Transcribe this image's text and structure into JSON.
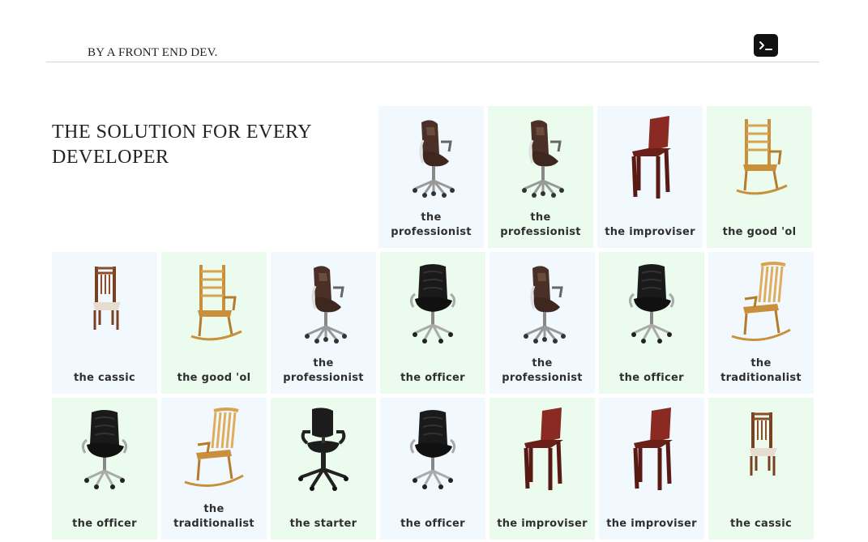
{
  "header": {
    "brand": "BY A FRONT END DEV.",
    "terminal_icon": "terminal-icon"
  },
  "hero": {
    "title": "THE SOLUTION FOR EVERY DEVELOPER"
  },
  "colors": {
    "blue_card": "#f1f8fe",
    "green_card": "#ebfcee"
  },
  "cards": [
    {
      "label": "the professionist",
      "chair": "professionist",
      "tint": "blue"
    },
    {
      "label": "the professionist",
      "chair": "professionist",
      "tint": "green"
    },
    {
      "label": "the improviser",
      "chair": "improviser",
      "tint": "blue"
    },
    {
      "label": "the good 'ol",
      "chair": "goodol",
      "tint": "green"
    },
    {
      "label": "the cassic",
      "chair": "cassic",
      "tint": "blue"
    },
    {
      "label": "the good 'ol",
      "chair": "goodol",
      "tint": "green"
    },
    {
      "label": "the professionist",
      "chair": "professionist",
      "tint": "blue"
    },
    {
      "label": "the officer",
      "chair": "officer",
      "tint": "green"
    },
    {
      "label": "the professionist",
      "chair": "professionist",
      "tint": "blue"
    },
    {
      "label": "the officer",
      "chair": "officer",
      "tint": "green"
    },
    {
      "label": "the traditionalist",
      "chair": "traditionalist",
      "tint": "blue"
    },
    {
      "label": "the officer",
      "chair": "officer",
      "tint": "green"
    },
    {
      "label": "the traditionalist",
      "chair": "traditionalist",
      "tint": "blue"
    },
    {
      "label": "the starter",
      "chair": "starter",
      "tint": "green"
    },
    {
      "label": "the officer",
      "chair": "officer",
      "tint": "blue"
    },
    {
      "label": "the improviser",
      "chair": "improviser",
      "tint": "green"
    },
    {
      "label": "the improviser",
      "chair": "improviser",
      "tint": "blue"
    },
    {
      "label": "the cassic",
      "chair": "cassic",
      "tint": "green"
    }
  ]
}
